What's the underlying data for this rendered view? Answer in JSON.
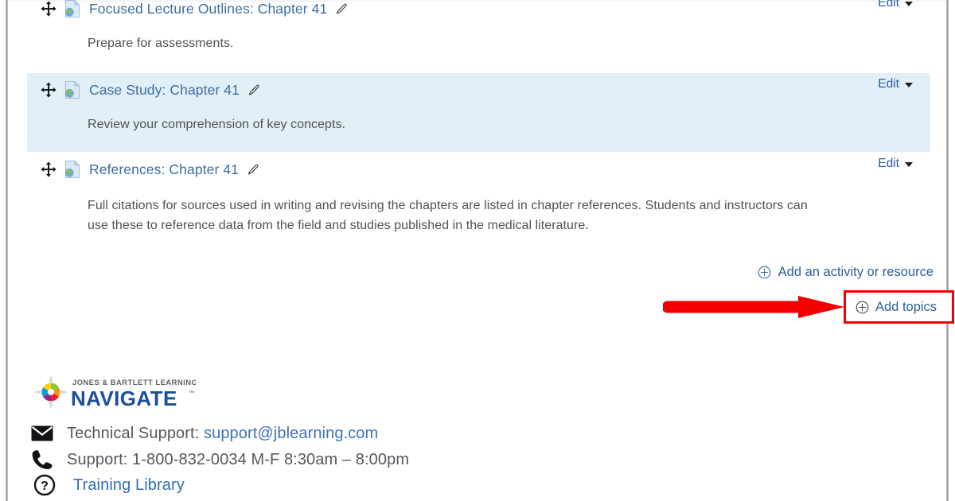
{
  "activities": [
    {
      "id": "focused-lecture-outlines",
      "move_icon": "move-arrows-icon",
      "type_icon": "page-resource-icon",
      "title": "Focused Lecture Outlines: Chapter 41",
      "edit_icon": "pencil-icon",
      "description": "Prepare for assessments.",
      "edit_label": "Edit",
      "highlighted": false
    },
    {
      "id": "case-study",
      "move_icon": "move-arrows-icon",
      "type_icon": "page-resource-icon",
      "title": "Case Study: Chapter 41",
      "edit_icon": "pencil-icon",
      "description": "Review your comprehension of key concepts.",
      "edit_label": "Edit",
      "highlighted": true
    },
    {
      "id": "references",
      "move_icon": "move-arrows-icon",
      "type_icon": "page-resource-icon",
      "title": "References: Chapter 41",
      "edit_icon": "pencil-icon",
      "description": "Full citations for sources used in writing and revising the chapters are listed in chapter references. Students and instructors can use these to reference data from the field and studies published in the medical literature.",
      "edit_label": "Edit",
      "highlighted": false
    }
  ],
  "actions": {
    "add_activity_label": "Add an activity or resource",
    "add_activity_icon": "plus-circle-icon",
    "add_topics_label": "Add topics",
    "add_topics_icon": "plus-circle-icon",
    "annotation_arrow_icon": "red-arrow-icon"
  },
  "footer": {
    "logo": {
      "icon": "navigate-compass-logo-icon",
      "brand_top": "JONES & BARTLETT LEARNING",
      "brand_main": "NAVIGATE",
      "trademark": "™"
    },
    "support_email_row": {
      "icon": "envelope-icon",
      "label": "Technical Support: ",
      "email": "support@jblearning.com"
    },
    "support_phone_row": {
      "icon": "phone-icon",
      "text": "Support: 1-800-832-0034 M-F 8:30am – 8:00pm"
    },
    "training_row": {
      "icon": "question-mark-circle-icon",
      "link": "Training Library"
    }
  },
  "colors": {
    "link_blue": "#3c6ea3",
    "edit_blue": "#2b5f9e",
    "highlight_bg": "#e2eff7",
    "annotation_red": "#f20000",
    "body_text": "#4f5256"
  }
}
